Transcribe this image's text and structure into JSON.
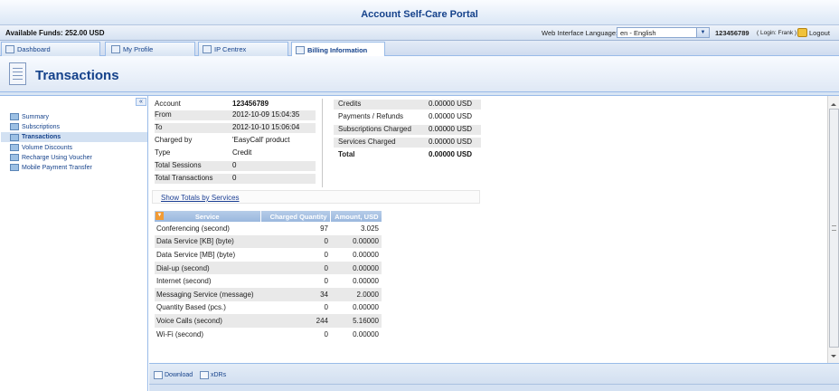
{
  "window": {
    "title": "Account Self-Care Portal"
  },
  "infobar": {
    "available_funds": "Available Funds: 252.00 USD",
    "language_label": "Web Interface Language:",
    "language_value": "en - English",
    "account_id": "123456789",
    "login_info": "( Login: Frank )",
    "logout_label": "Logout"
  },
  "tabs": [
    {
      "label": "Dashboard"
    },
    {
      "label": "My Profile"
    },
    {
      "label": "IP Centrex"
    },
    {
      "label": "Billing Information"
    }
  ],
  "header": {
    "title": "Transactions"
  },
  "sidebar": {
    "collapse_label": "«",
    "items": [
      {
        "label": "Summary"
      },
      {
        "label": "Subscriptions"
      },
      {
        "label": "Transactions"
      },
      {
        "label": "Volume Discounts"
      },
      {
        "label": "Recharge Using Voucher"
      },
      {
        "label": "Mobile Payment Transfer"
      }
    ]
  },
  "details": [
    {
      "k": "Account",
      "v": "123456789"
    },
    {
      "k": "From",
      "v": "2012-10-09 15:04:35"
    },
    {
      "k": "To",
      "v": "2012-10-10 15:06:04"
    },
    {
      "k": "Charged by",
      "v": "'EasyCall' product"
    },
    {
      "k": "Type",
      "v": "Credit"
    },
    {
      "k": "Total Sessions",
      "v": "0"
    },
    {
      "k": "Total Transactions",
      "v": "0"
    }
  ],
  "totals": [
    {
      "k": "Credits",
      "v": "0.00000 USD"
    },
    {
      "k": "Payments / Refunds",
      "v": "0.00000 USD"
    },
    {
      "k": "Subscriptions Charged",
      "v": "0.00000 USD"
    },
    {
      "k": "Services Charged",
      "v": "0.00000 USD"
    },
    {
      "k": "Total",
      "v": "0.00000 USD"
    }
  ],
  "show_totals_link": "Show Totals by Services",
  "services_table": {
    "headers": {
      "service": "Service",
      "qty": "Charged Quantity",
      "amount": "Amount, USD"
    },
    "rows": [
      {
        "service": "Conferencing (second)",
        "qty": "97",
        "amount": "3.025"
      },
      {
        "service": "Data Service [KB] (byte)",
        "qty": "0",
        "amount": "0.00000"
      },
      {
        "service": "Data Service [MB] (byte)",
        "qty": "0",
        "amount": "0.00000"
      },
      {
        "service": "Dial-up (second)",
        "qty": "0",
        "amount": "0.00000"
      },
      {
        "service": "Internet (second)",
        "qty": "0",
        "amount": "0.00000"
      },
      {
        "service": "Messaging Service (message)",
        "qty": "34",
        "amount": "2.0000"
      },
      {
        "service": "Quantity Based (pcs.)",
        "qty": "0",
        "amount": "0.00000"
      },
      {
        "service": "Voice Calls (second)",
        "qty": "244",
        "amount": "5.16000"
      },
      {
        "service": "Wi-Fi (second)",
        "qty": "0",
        "amount": "0.00000"
      }
    ]
  },
  "bottom": {
    "download_label": "Download",
    "xdrs_label": "xDRs"
  }
}
